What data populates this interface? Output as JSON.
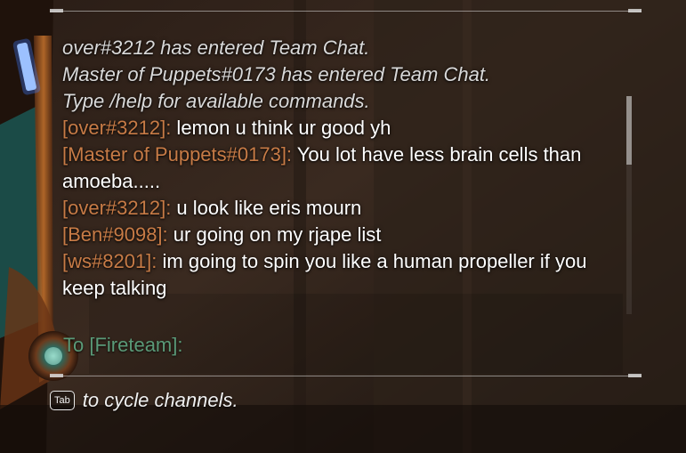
{
  "chat": {
    "messages": [
      {
        "type": "system",
        "text": "over#3212 has entered Team Chat."
      },
      {
        "type": "system",
        "text": "Master of Puppets#0173 has entered Team Chat."
      },
      {
        "type": "system",
        "text": "Type /help for available commands."
      },
      {
        "type": "player",
        "sender": "[over#3212]:",
        "text": " lemon u think ur good yh"
      },
      {
        "type": "player",
        "sender": "[Master of Puppets#0173]:",
        "text": " You lot have less brain cells than amoeba....."
      },
      {
        "type": "player",
        "sender": "[over#3212]:",
        "text": " u look like eris mourn"
      },
      {
        "type": "player",
        "sender": "[Ben#9098]:",
        "text": " ur going on my rjape list"
      },
      {
        "type": "player",
        "sender": "[ws#8201]:",
        "text": " im going to spin you like a human propeller if you keep talking"
      }
    ],
    "input_prompt": "To [Fireteam]:",
    "scroll_position": 0.0
  },
  "hint": {
    "key_label": "Tab",
    "text": "to cycle channels."
  },
  "colors": {
    "sender": "#c77b46",
    "system_text": "#d9d9d9",
    "message_text": "#ffffff",
    "input_prompt": "#5a9a78"
  }
}
